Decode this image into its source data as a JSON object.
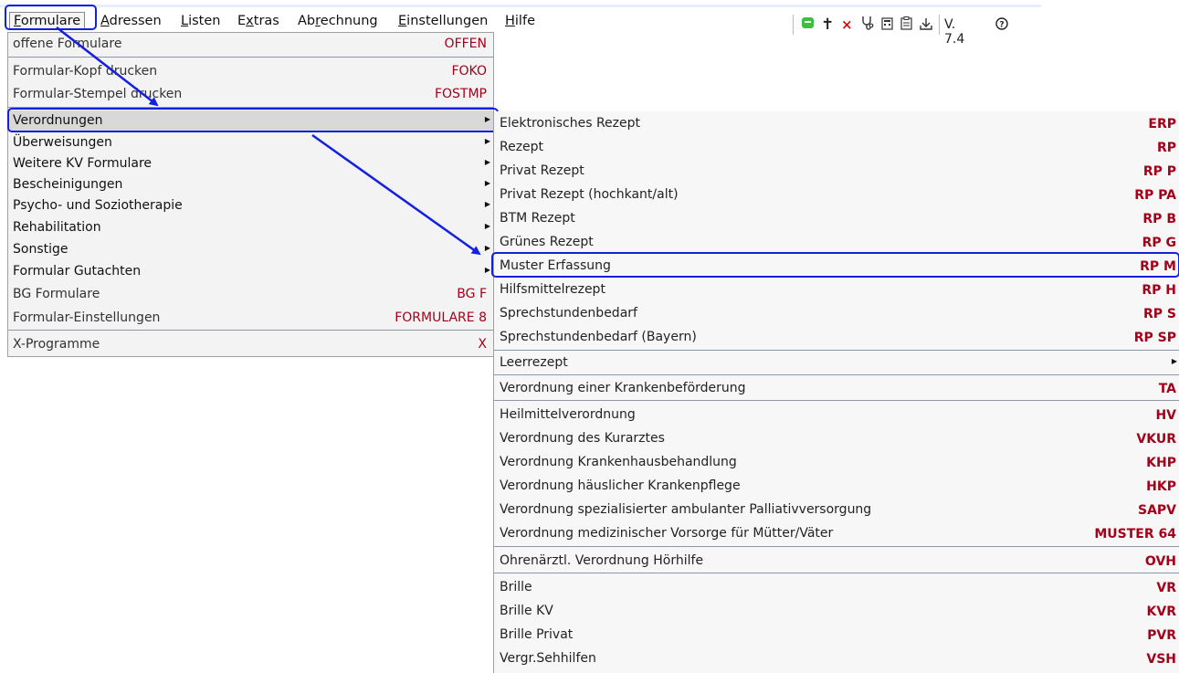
{
  "menubar": {
    "items": [
      {
        "pre": "",
        "acc": "F",
        "post": "ormulare"
      },
      {
        "pre": "",
        "acc": "A",
        "post": "dressen"
      },
      {
        "pre": "",
        "acc": "L",
        "post": "isten"
      },
      {
        "pre": "E",
        "acc": "x",
        "post": "tras"
      },
      {
        "pre": "Ab",
        "acc": "r",
        "post": "echnung"
      },
      {
        "pre": "",
        "acc": "E",
        "post": "instellungen"
      },
      {
        "pre": "",
        "acc": "H",
        "post": "ilfe"
      }
    ],
    "version": "V. 7.4",
    "icons": [
      "chat-icon",
      "cross-icon",
      "close-icon",
      "stethoscope-icon",
      "calculator-icon",
      "clipboard-icon",
      "download-icon",
      "help-icon"
    ]
  },
  "dropdown": {
    "items": [
      {
        "label": "offene Formulare",
        "code": "OFFEN"
      },
      {
        "label": "Formular-Kopf drucken",
        "code": "FOKO"
      },
      {
        "label": "Formular-Stempel drucken",
        "code": "FOSTMP"
      },
      {
        "label": "Verordnungen",
        "code": ""
      },
      {
        "label": "Überweisungen",
        "code": ""
      },
      {
        "label": "Weitere KV Formulare",
        "code": ""
      },
      {
        "label": "Bescheinigungen",
        "code": ""
      },
      {
        "label": "Psycho- und Soziotherapie",
        "code": ""
      },
      {
        "label": "Rehabilitation",
        "code": ""
      },
      {
        "label": "Sonstige",
        "code": ""
      },
      {
        "label": "Formular Gutachten",
        "code": ""
      },
      {
        "label": "BG Formulare",
        "code": "BG F"
      },
      {
        "label": "Formular-Einstellungen",
        "code": "FORMULARE 8"
      },
      {
        "label": "X-Programme",
        "code": "X"
      }
    ]
  },
  "submenu": {
    "items": [
      {
        "label": "Elektronisches Rezept",
        "code": "ERP"
      },
      {
        "label": "Rezept",
        "code": "RP"
      },
      {
        "label": "Privat Rezept",
        "code": "RP P"
      },
      {
        "label": "Privat Rezept (hochkant/alt)",
        "code": "RP PA"
      },
      {
        "label": "BTM Rezept",
        "code": "RP B"
      },
      {
        "label": "Grünes Rezept",
        "code": "RP G"
      },
      {
        "label": "Muster Erfassung",
        "code": "RP M"
      },
      {
        "label": "Hilfsmittelrezept",
        "code": "RP H"
      },
      {
        "label": "Sprechstundenbedarf",
        "code": "RP S"
      },
      {
        "label": "Sprechstundenbedarf (Bayern)",
        "code": "RP SP"
      },
      {
        "label": "Leerrezept",
        "code": ""
      },
      {
        "label": "Verordnung einer Krankenbeförderung",
        "code": "TA"
      },
      {
        "label": "Heilmittelverordnung",
        "code": "HV"
      },
      {
        "label": "Verordnung des Kurarztes",
        "code": "VKUR"
      },
      {
        "label": "Verordnung Krankenhausbehandlung",
        "code": "KHP"
      },
      {
        "label": "Verordnung häuslicher Krankenpflege",
        "code": "HKP"
      },
      {
        "label": "Verordnung spezialisierter ambulanter Palliativversorgung",
        "code": "SAPV"
      },
      {
        "label": "Verordnung medizinischer Vorsorge für Mütter/Väter",
        "code": "MUSTER 64"
      },
      {
        "label": "Ohrenärztl. Verordnung Hörhilfe",
        "code": "OVH"
      },
      {
        "label": "Brille",
        "code": "VR"
      },
      {
        "label": "Brille KV",
        "code": "KVR"
      },
      {
        "label": "Brille Privat",
        "code": "PVR"
      },
      {
        "label": "Vergr.Sehhilfen",
        "code": "VSH"
      }
    ]
  },
  "colors": {
    "highlight": "#1420e0",
    "code": "#a3001a"
  }
}
